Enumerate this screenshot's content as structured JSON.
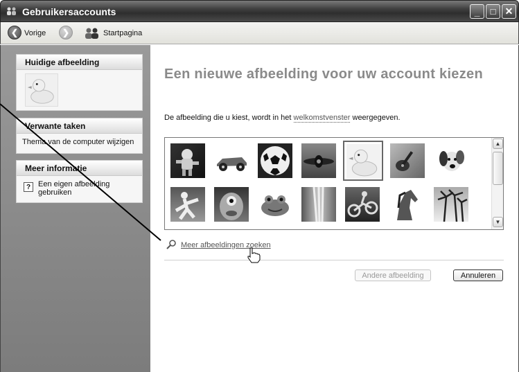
{
  "window": {
    "title": "Gebruikersaccounts",
    "controls": {
      "minimize": "_",
      "maximize": "□",
      "close": "✕"
    }
  },
  "toolbar": {
    "back_label": "Vorige",
    "home_label": "Startpagina"
  },
  "sidebar": {
    "current_picture": {
      "header": "Huidige afbeelding",
      "image": "rubber-duck"
    },
    "related_tasks": {
      "header": "Verwante taken",
      "items": [
        "Thema van de computer wijzigen"
      ]
    },
    "more_info": {
      "header": "Meer informatie",
      "items": [
        "Een eigen afbeelding gebruiken"
      ]
    }
  },
  "main": {
    "heading": "Een nieuwe afbeelding voor uw account kiezen",
    "description_before": "De afbeelding die u kiest, wordt in het ",
    "description_link": "welkomstvenster",
    "description_after": " weergegeven.",
    "pictures": [
      "astronaut",
      "race-car",
      "soccer-ball",
      "airplane",
      "rubber-duck",
      "guitar",
      "dog",
      "karate",
      "fish",
      "frog",
      "waterfall",
      "motorbike",
      "horse",
      "palm-trees"
    ],
    "selected_picture": "rubber-duck",
    "more_pictures_link": "Meer afbeeldingen zoeken",
    "change_button": "Andere afbeelding",
    "cancel_button": "Annuleren"
  },
  "colors": {
    "titlebar": "#3f3f3f",
    "sidebar": "#8a8a8a",
    "heading": "#8a8a8a"
  }
}
